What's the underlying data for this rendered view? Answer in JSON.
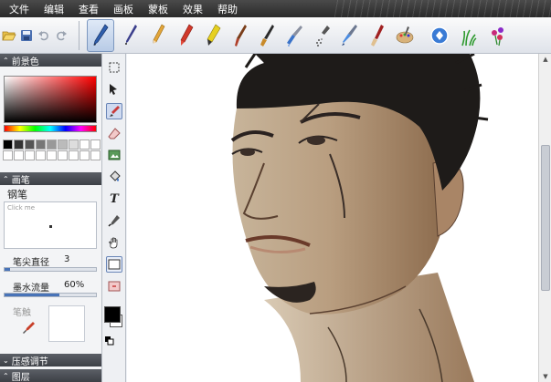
{
  "menubar": {
    "items": [
      "文件",
      "编辑",
      "查看",
      "画板",
      "蒙板",
      "效果",
      "帮助"
    ]
  },
  "toolbar": {
    "file_buttons": [
      "open-folder-icon",
      "save-icon",
      "undo-icon",
      "redo-icon"
    ],
    "brushes": [
      "pen",
      "fine-pen",
      "pencil",
      "crayon",
      "marker",
      "brush",
      "flat-brush",
      "airbrush",
      "spray",
      "fountain",
      "oil-brush",
      "palette",
      "smudge",
      "grass",
      "flower"
    ],
    "selected_brush": "pen"
  },
  "panel": {
    "foreground": {
      "header": "前景色"
    },
    "brush": {
      "header": "画笔",
      "name": "钢笔",
      "preview_hint": "Click me",
      "size_label": "笔尖直径",
      "size_value": "3",
      "size_fraction": 0.06,
      "flow_label": "墨水流量",
      "flow_value": "60%",
      "flow_fraction": 0.6,
      "nib_label": "笔触"
    },
    "pressure": {
      "header": "压感调节"
    },
    "layers": {
      "header": "图层"
    },
    "swatches": [
      "#000000",
      "#333333",
      "#555555",
      "#777777",
      "#999999",
      "#bbbbbb",
      "#dddddd",
      "#ffffff",
      "#ffffff",
      "#ffffff",
      "#ffffff",
      "#ffffff",
      "#ffffff",
      "#ffffff",
      "#ffffff",
      "#ffffff",
      "#ffffff",
      "#ffffff"
    ]
  },
  "tools": [
    "marquee",
    "move",
    "brush",
    "eraser",
    "transform",
    "fill",
    "text",
    "eyedropper",
    "hand",
    "rectangle",
    "rect-erase"
  ],
  "selected_tool": "brush"
}
